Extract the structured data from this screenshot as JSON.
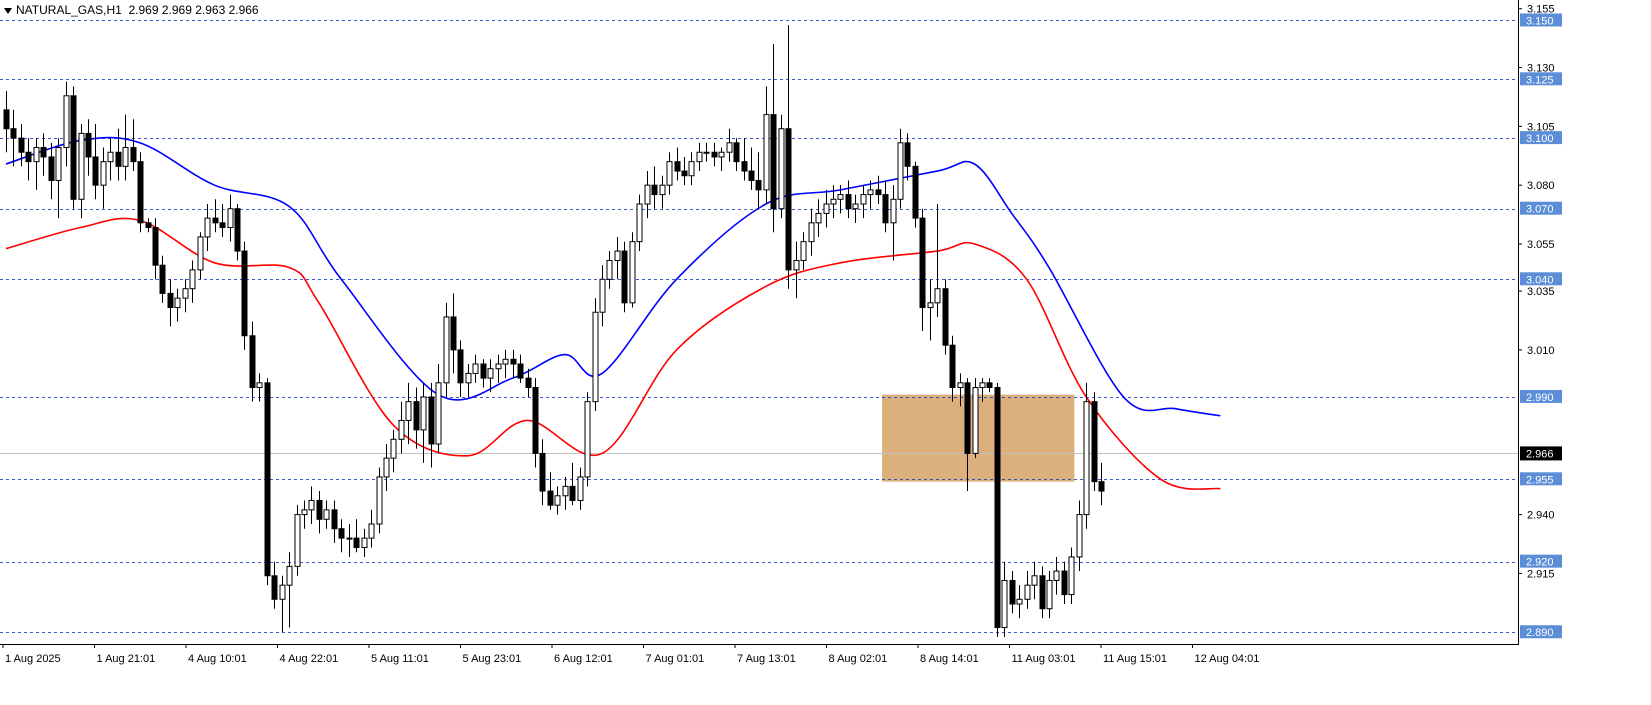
{
  "header": {
    "symbol": "NATURAL_GAS,H1",
    "ohlc": "2.969 2.969 2.963 2.966"
  },
  "colors": {
    "background": "#ffffff",
    "candle": "#000000",
    "grid_line": "#1a3cc8",
    "hl_label_bg": "#5b8ed6",
    "hl_label_text": "#ffffff",
    "current_price_bg": "#000000",
    "current_price_text": "#ffffff",
    "ma_fast": "#0000ff",
    "ma_slow": "#ff0000",
    "zone_fill": "#dcb07c",
    "current_line": "#c0c0c0"
  },
  "chart_data": {
    "type": "candlestick",
    "ylim": [
      2.885,
      3.157
    ],
    "y_ticks": [
      "3.155",
      "3.130",
      "3.105",
      "3.080",
      "3.055",
      "3.035",
      "3.010",
      "2.940",
      "2.915"
    ],
    "highlighted_levels": [
      "3.150",
      "3.125",
      "3.100",
      "3.070",
      "3.040",
      "2.990",
      "2.955",
      "2.920",
      "2.890"
    ],
    "current_price": "2.966",
    "x_labels": [
      "1 Aug 2025",
      "1 Aug 21:01",
      "4 Aug 10:01",
      "4 Aug 22:01",
      "5 Aug 11:01",
      "5 Aug 23:01",
      "6 Aug 12:01",
      "7 Aug 01:01",
      "7 Aug 13:01",
      "8 Aug 02:01",
      "8 Aug 14:01",
      "11 Aug 03:01",
      "11 Aug 15:01",
      "12 Aug 04:01"
    ],
    "candle_count": 154,
    "zone": {
      "bar_start": 118,
      "bar_end": 143,
      "price_top": 2.991,
      "price_bottom": 2.954
    },
    "ohlc": [
      [
        3.112,
        3.12,
        3.094,
        3.104
      ],
      [
        3.104,
        3.112,
        3.088,
        3.1
      ],
      [
        3.1,
        3.106,
        3.088,
        3.094
      ],
      [
        3.094,
        3.1,
        3.082,
        3.09
      ],
      [
        3.09,
        3.1,
        3.078,
        3.096
      ],
      [
        3.096,
        3.102,
        3.084,
        3.092
      ],
      [
        3.092,
        3.098,
        3.074,
        3.082
      ],
      [
        3.082,
        3.1,
        3.066,
        3.096
      ],
      [
        3.096,
        3.124,
        3.088,
        3.118
      ],
      [
        3.118,
        3.122,
        3.07,
        3.074
      ],
      [
        3.074,
        3.106,
        3.066,
        3.102
      ],
      [
        3.102,
        3.108,
        3.084,
        3.092
      ],
      [
        3.092,
        3.106,
        3.074,
        3.08
      ],
      [
        3.08,
        3.096,
        3.07,
        3.09
      ],
      [
        3.09,
        3.1,
        3.082,
        3.094
      ],
      [
        3.094,
        3.104,
        3.082,
        3.088
      ],
      [
        3.088,
        3.11,
        3.082,
        3.096
      ],
      [
        3.096,
        3.108,
        3.086,
        3.09
      ],
      [
        3.09,
        3.094,
        3.06,
        3.064
      ],
      [
        3.064,
        3.066,
        3.06,
        3.062
      ],
      [
        3.062,
        3.066,
        3.04,
        3.046
      ],
      [
        3.046,
        3.05,
        3.03,
        3.034
      ],
      [
        3.034,
        3.04,
        3.02,
        3.028
      ],
      [
        3.028,
        3.036,
        3.022,
        3.032
      ],
      [
        3.032,
        3.04,
        3.026,
        3.036
      ],
      [
        3.036,
        3.048,
        3.03,
        3.044
      ],
      [
        3.044,
        3.06,
        3.04,
        3.058
      ],
      [
        3.058,
        3.072,
        3.052,
        3.066
      ],
      [
        3.066,
        3.074,
        3.06,
        3.064
      ],
      [
        3.064,
        3.072,
        3.058,
        3.062
      ],
      [
        3.062,
        3.076,
        3.056,
        3.07
      ],
      [
        3.07,
        3.072,
        3.048,
        3.052
      ],
      [
        3.052,
        3.056,
        3.01,
        3.016
      ],
      [
        3.016,
        3.022,
        2.988,
        2.994
      ],
      [
        2.994,
        3.0,
        2.988,
        2.996
      ],
      [
        2.996,
        2.998,
        2.91,
        2.914
      ],
      [
        2.914,
        2.92,
        2.9,
        2.904
      ],
      [
        2.904,
        2.914,
        2.89,
        2.91
      ],
      [
        2.91,
        2.924,
        2.892,
        2.918
      ],
      [
        2.918,
        2.944,
        2.914,
        2.94
      ],
      [
        2.94,
        2.946,
        2.934,
        2.942
      ],
      [
        2.942,
        2.952,
        2.936,
        2.946
      ],
      [
        2.946,
        2.95,
        2.932,
        2.938
      ],
      [
        2.938,
        2.946,
        2.934,
        2.942
      ],
      [
        2.942,
        2.946,
        2.928,
        2.934
      ],
      [
        2.934,
        2.938,
        2.924,
        2.93
      ],
      [
        2.93,
        2.936,
        2.922,
        2.93
      ],
      [
        2.93,
        2.938,
        2.924,
        2.926
      ],
      [
        2.926,
        2.934,
        2.922,
        2.93
      ],
      [
        2.93,
        2.942,
        2.926,
        2.936
      ],
      [
        2.936,
        2.96,
        2.932,
        2.956
      ],
      [
        2.956,
        2.97,
        2.95,
        2.964
      ],
      [
        2.964,
        2.976,
        2.958,
        2.972
      ],
      [
        2.972,
        2.988,
        2.966,
        2.98
      ],
      [
        2.98,
        2.996,
        2.97,
        2.988
      ],
      [
        2.988,
        2.994,
        2.968,
        2.976
      ],
      [
        2.976,
        2.996,
        2.962,
        2.99
      ],
      [
        2.99,
        2.996,
        2.96,
        2.97
      ],
      [
        2.97,
        3.004,
        2.966,
        2.996
      ],
      [
        2.996,
        3.03,
        2.99,
        3.024
      ],
      [
        3.024,
        3.034,
        3.0,
        3.01
      ],
      [
        3.01,
        3.014,
        2.99,
        2.996
      ],
      [
        2.996,
        3.004,
        2.99,
        3.0
      ],
      [
        3.0,
        3.008,
        2.996,
        3.004
      ],
      [
        3.004,
        3.006,
        2.994,
        2.998
      ],
      [
        2.998,
        3.006,
        2.992,
        3.002
      ],
      [
        3.002,
        3.008,
        2.996,
        3.004
      ],
      [
        3.004,
        3.01,
        2.998,
        3.006
      ],
      [
        3.006,
        3.01,
        2.998,
        3.004
      ],
      [
        3.004,
        3.008,
        2.996,
        2.998
      ],
      [
        2.998,
        3.002,
        2.99,
        2.994
      ],
      [
        2.994,
        2.998,
        2.96,
        2.966
      ],
      [
        2.966,
        2.972,
        2.944,
        2.95
      ],
      [
        2.95,
        2.958,
        2.942,
        2.944
      ],
      [
        2.944,
        2.952,
        2.94,
        2.948
      ],
      [
        2.948,
        2.956,
        2.942,
        2.952
      ],
      [
        2.952,
        2.962,
        2.944,
        2.946
      ],
      [
        2.946,
        2.96,
        2.942,
        2.956
      ],
      [
        2.956,
        2.992,
        2.952,
        2.988
      ],
      [
        2.988,
        3.032,
        2.984,
        3.026
      ],
      [
        3.026,
        3.046,
        3.02,
        3.04
      ],
      [
        3.04,
        3.052,
        3.036,
        3.048
      ],
      [
        3.048,
        3.058,
        3.04,
        3.052
      ],
      [
        3.052,
        3.056,
        3.026,
        3.03
      ],
      [
        3.03,
        3.06,
        3.028,
        3.056
      ],
      [
        3.056,
        3.076,
        3.052,
        3.072
      ],
      [
        3.072,
        3.086,
        3.066,
        3.08
      ],
      [
        3.08,
        3.088,
        3.07,
        3.076
      ],
      [
        3.076,
        3.084,
        3.07,
        3.08
      ],
      [
        3.08,
        3.094,
        3.076,
        3.09
      ],
      [
        3.09,
        3.096,
        3.082,
        3.086
      ],
      [
        3.086,
        3.092,
        3.08,
        3.084
      ],
      [
        3.084,
        3.094,
        3.08,
        3.09
      ],
      [
        3.09,
        3.098,
        3.086,
        3.094
      ],
      [
        3.094,
        3.098,
        3.09,
        3.094
      ],
      [
        3.094,
        3.098,
        3.088,
        3.092
      ],
      [
        3.092,
        3.096,
        3.086,
        3.094
      ],
      [
        3.094,
        3.104,
        3.09,
        3.098
      ],
      [
        3.098,
        3.1,
        3.086,
        3.09
      ],
      [
        3.09,
        3.1,
        3.082,
        3.086
      ],
      [
        3.086,
        3.096,
        3.078,
        3.082
      ],
      [
        3.082,
        3.094,
        3.07,
        3.078
      ],
      [
        3.078,
        3.122,
        3.072,
        3.11
      ],
      [
        3.11,
        3.14,
        3.06,
        3.07
      ],
      [
        3.07,
        3.11,
        3.066,
        3.104
      ],
      [
        3.104,
        3.148,
        3.036,
        3.044
      ],
      [
        3.044,
        3.056,
        3.032,
        3.048
      ],
      [
        3.048,
        3.06,
        3.044,
        3.056
      ],
      [
        3.056,
        3.07,
        3.05,
        3.064
      ],
      [
        3.064,
        3.074,
        3.058,
        3.068
      ],
      [
        3.068,
        3.078,
        3.062,
        3.072
      ],
      [
        3.072,
        3.08,
        3.066,
        3.074
      ],
      [
        3.074,
        3.08,
        3.068,
        3.076
      ],
      [
        3.076,
        3.082,
        3.066,
        3.07
      ],
      [
        3.07,
        3.076,
        3.064,
        3.072
      ],
      [
        3.072,
        3.08,
        3.066,
        3.076
      ],
      [
        3.076,
        3.082,
        3.07,
        3.078
      ],
      [
        3.078,
        3.084,
        3.072,
        3.076
      ],
      [
        3.076,
        3.082,
        3.06,
        3.064
      ],
      [
        3.064,
        3.08,
        3.048,
        3.074
      ],
      [
        3.074,
        3.104,
        3.07,
        3.098
      ],
      [
        3.098,
        3.102,
        3.082,
        3.088
      ],
      [
        3.088,
        3.09,
        3.062,
        3.066
      ],
      [
        3.066,
        3.07,
        3.018,
        3.028
      ],
      [
        3.028,
        3.04,
        3.014,
        3.03
      ],
      [
        3.03,
        3.072,
        3.024,
        3.036
      ],
      [
        3.036,
        3.04,
        3.008,
        3.012
      ],
      [
        3.012,
        3.016,
        2.988,
        2.994
      ],
      [
        2.994,
        3.0,
        2.986,
        2.996
      ],
      [
        2.996,
        2.998,
        2.95,
        2.966
      ],
      [
        2.966,
        2.998,
        2.964,
        2.994
      ],
      [
        2.994,
        2.998,
        2.988,
        2.996
      ],
      [
        2.996,
        2.998,
        2.992,
        2.994
      ],
      [
        2.994,
        2.996,
        2.888,
        2.892
      ],
      [
        2.892,
        2.92,
        2.888,
        2.912
      ],
      [
        2.912,
        2.916,
        2.898,
        2.902
      ],
      [
        2.902,
        2.91,
        2.896,
        2.904
      ],
      [
        2.904,
        2.916,
        2.9,
        2.91
      ],
      [
        2.91,
        2.92,
        2.904,
        2.914
      ],
      [
        2.914,
        2.918,
        2.896,
        2.9
      ],
      [
        2.9,
        2.916,
        2.896,
        2.912
      ],
      [
        2.912,
        2.922,
        2.906,
        2.916
      ],
      [
        2.916,
        2.92,
        2.902,
        2.906
      ],
      [
        2.906,
        2.926,
        2.902,
        2.922
      ],
      [
        2.922,
        2.946,
        2.916,
        2.94
      ],
      [
        2.94,
        2.996,
        2.934,
        2.988
      ],
      [
        2.988,
        2.992,
        2.95,
        2.954
      ],
      [
        2.954,
        2.962,
        2.944,
        2.95
      ]
    ],
    "ma_fast_points": [
      [
        0,
        3.089
      ],
      [
        10,
        3.099
      ],
      [
        18,
        3.098
      ],
      [
        28,
        3.08
      ],
      [
        38,
        3.071
      ],
      [
        45,
        3.04
      ],
      [
        58,
        2.991
      ],
      [
        68,
        2.998
      ],
      [
        75,
        3.008
      ],
      [
        80,
        3.0
      ],
      [
        90,
        3.04
      ],
      [
        102,
        3.072
      ],
      [
        112,
        3.078
      ],
      [
        125,
        3.086
      ],
      [
        130,
        3.089
      ],
      [
        135,
        3.068
      ],
      [
        140,
        3.045
      ],
      [
        150,
        2.99
      ],
      [
        157,
        2.985
      ],
      [
        163,
        2.982
      ]
    ],
    "ma_slow_points": [
      [
        0,
        3.053
      ],
      [
        10,
        3.062
      ],
      [
        18,
        3.065
      ],
      [
        28,
        3.047
      ],
      [
        38,
        3.045
      ],
      [
        42,
        3.03
      ],
      [
        52,
        2.978
      ],
      [
        62,
        2.965
      ],
      [
        70,
        2.98
      ],
      [
        80,
        2.966
      ],
      [
        90,
        3.01
      ],
      [
        102,
        3.037
      ],
      [
        112,
        3.047
      ],
      [
        125,
        3.052
      ],
      [
        130,
        3.055
      ],
      [
        137,
        3.04
      ],
      [
        145,
        2.99
      ],
      [
        155,
        2.955
      ],
      [
        163,
        2.951
      ]
    ]
  }
}
